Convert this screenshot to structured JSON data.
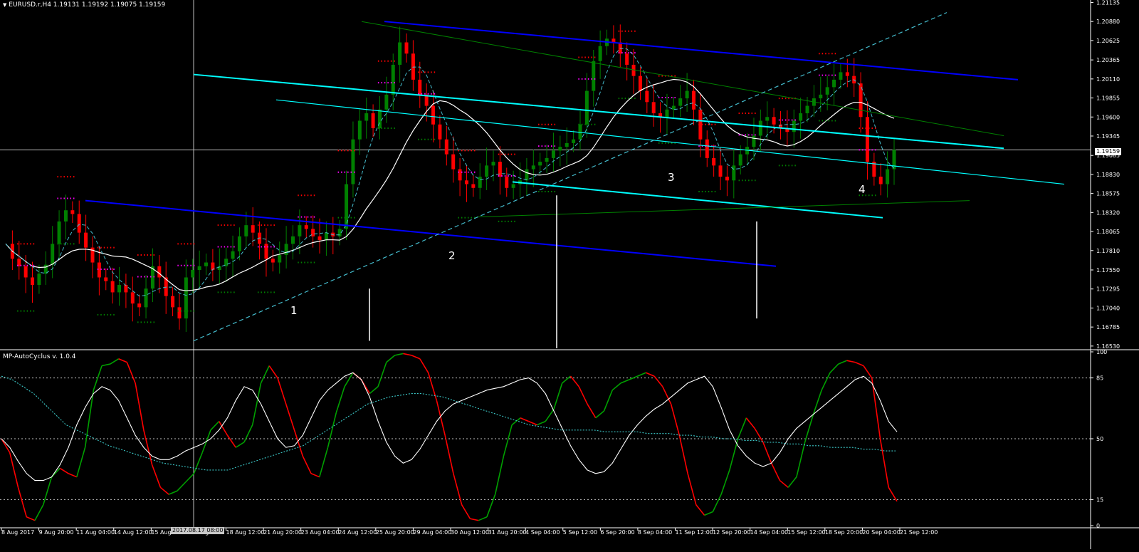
{
  "window": {
    "symbol_info": "EURUSD.r,H4  1.19131 1.19192 1.19075 1.19159",
    "indicator_title": "MP-AutoCyclus v. 1.0.4",
    "current_price": "1.19159",
    "crosshair_time": "2017.08.17 08:00"
  },
  "colors": {
    "background": "#000000",
    "bull": "#008000",
    "bear": "#ff0000",
    "ma": "#ffffff",
    "channel_blue": "#0000ff",
    "channel_cyan": "#00ffff",
    "trend_green": "#008000",
    "dashed_cyan": "#44bbcc",
    "osc_green": "#00a000",
    "osc_red": "#ff0000",
    "osc_signal": "#ffffff",
    "osc_slow": "#3cc8c8",
    "grid": "#c0c0c0"
  },
  "chart_data": [
    {
      "type": "candlestick",
      "title": "EURUSD.r,H4",
      "ohlc_last": {
        "open": 1.19131,
        "high": 1.19192,
        "low": 1.19075,
        "close": 1.19159
      },
      "ylim": [
        1.165,
        1.2113
      ],
      "y_ticks": [
        "1.21135",
        "1.20880",
        "1.20625",
        "1.20365",
        "1.20110",
        "1.19855",
        "1.19600",
        "1.19345",
        "1.19085",
        "1.18830",
        "1.18575",
        "1.18320",
        "1.18065",
        "1.17810",
        "1.17550",
        "1.17295",
        "1.17040",
        "1.16785",
        "1.16530"
      ],
      "x_ticks": [
        "8 Aug 2017",
        "9 Aug 20:00",
        "11 Aug 04:00",
        "14 Aug 12:00",
        "15 Aug",
        "17 Aug",
        "18 Aug 12:00",
        "21 Aug 20:00",
        "23 Aug 04:00",
        "24 Aug 12:00",
        "25 Aug 20:00",
        "29 Aug 04:00",
        "30 Aug 12:00",
        "31 Aug 20:00",
        "4 Sep 04:00",
        "5 Sep 12:00",
        "6 Sep 20:00",
        "8 Sep 04:00",
        "11 Sep 12:00",
        "12 Sep 20:00",
        "14 Sep 04:00",
        "15 Sep 12:00",
        "18 Sep 20:00",
        "20 Sep 04:00",
        "21 Sep 12:00"
      ],
      "annotations": [
        "1",
        "2",
        "3",
        "4"
      ],
      "close_path": [
        1.179,
        1.177,
        1.176,
        1.1745,
        1.1735,
        1.175,
        1.1762,
        1.179,
        1.182,
        1.1835,
        1.183,
        1.1805,
        1.1785,
        1.1765,
        1.1745,
        1.174,
        1.1725,
        1.1735,
        1.1725,
        1.171,
        1.1705,
        1.173,
        1.176,
        1.1745,
        1.172,
        1.1705,
        1.169,
        1.1745,
        1.1755,
        1.176,
        1.1765,
        1.1755,
        1.176,
        1.177,
        1.178,
        1.18,
        1.1815,
        1.1805,
        1.179,
        1.177,
        1.1765,
        1.1775,
        1.179,
        1.18,
        1.1815,
        1.181,
        1.18,
        1.1795,
        1.1805,
        1.18,
        1.181,
        1.187,
        1.193,
        1.1955,
        1.1965,
        1.1945,
        1.197,
        1.199,
        1.203,
        1.206,
        1.2045,
        1.201,
        1.199,
        1.1975,
        1.195,
        1.193,
        1.191,
        1.189,
        1.1875,
        1.187,
        1.1865,
        1.188,
        1.1895,
        1.19,
        1.188,
        1.1865,
        1.187,
        1.1875,
        1.189,
        1.1895,
        1.19,
        1.1905,
        1.1915,
        1.192,
        1.1925,
        1.193,
        1.195,
        1.1995,
        1.2035,
        1.2055,
        1.2065,
        1.206,
        1.2045,
        1.203,
        1.2015,
        1.1995,
        1.198,
        1.1965,
        1.196,
        1.197,
        1.1975,
        1.1985,
        1.1995,
        1.197,
        1.193,
        1.1905,
        1.1895,
        1.188,
        1.1875,
        1.1895,
        1.191,
        1.192,
        1.1935,
        1.1955,
        1.196,
        1.195,
        1.1945,
        1.194,
        1.1955,
        1.1965,
        1.1975,
        1.1985,
        1.199,
        1.2,
        1.201,
        1.202,
        1.2015,
        1.2005,
        1.196,
        1.19,
        1.188,
        1.187,
        1.189,
        1.1916
      ]
    },
    {
      "type": "line",
      "title": "MP-AutoCyclus v. 1.0.4",
      "ylim": [
        0,
        100
      ],
      "y_ticks": [
        "100",
        "85",
        "50",
        "15",
        "0"
      ],
      "series": [
        {
          "values": [
            50,
            42,
            22,
            5,
            3,
            12,
            28,
            33,
            30,
            28,
            45,
            78,
            92,
            93,
            96,
            94,
            82,
            55,
            35,
            22,
            18,
            20,
            25,
            30,
            42,
            55,
            60,
            52,
            45,
            48,
            58,
            82,
            92,
            85,
            70,
            55,
            40,
            30,
            28,
            45,
            65,
            80,
            88,
            84,
            76,
            80,
            94,
            98,
            99,
            98,
            96,
            88,
            72,
            52,
            30,
            12,
            4,
            3,
            5,
            18,
            40,
            58,
            62,
            60,
            58,
            60,
            67,
            82,
            86,
            80,
            70,
            62,
            66,
            78,
            82,
            84,
            86,
            88,
            86,
            80,
            70,
            52,
            30,
            12,
            6,
            8,
            18,
            32,
            50,
            62,
            56,
            48,
            36,
            26,
            22,
            28,
            48,
            64,
            78,
            88,
            93,
            95,
            94,
            92,
            85,
            50,
            22,
            14
          ]
        },
        {
          "values": [
            50,
            45,
            37,
            30,
            26,
            26,
            28,
            35,
            45,
            58,
            68,
            76,
            80,
            78,
            72,
            62,
            52,
            45,
            40,
            38,
            38,
            40,
            43,
            45,
            47,
            50,
            55,
            62,
            72,
            80,
            78,
            70,
            60,
            50,
            45,
            46,
            52,
            62,
            72,
            78,
            82,
            86,
            88,
            84,
            74,
            60,
            48,
            40,
            36,
            38,
            44,
            52,
            60,
            66,
            70,
            72,
            74,
            76,
            78,
            79,
            80,
            82,
            84,
            85,
            82,
            76,
            66,
            56,
            46,
            38,
            32,
            30,
            31,
            36,
            44,
            52,
            58,
            63,
            67,
            70,
            74,
            78,
            82,
            84,
            86,
            80,
            68,
            55,
            46,
            40,
            36,
            34,
            36,
            42,
            50,
            56,
            60,
            64,
            68,
            72,
            76,
            80,
            84,
            86,
            82,
            72,
            60,
            54
          ]
        },
        {
          "values": [
            86,
            84,
            80,
            76,
            70,
            64,
            58,
            55,
            52,
            49,
            46,
            44,
            42,
            40,
            38,
            36,
            35,
            34,
            33,
            32,
            32,
            32,
            34,
            36,
            38,
            40,
            42,
            44,
            46,
            50,
            54,
            58,
            62,
            66,
            70,
            72,
            74,
            75,
            76,
            76,
            75,
            74,
            72,
            70,
            68,
            66,
            64,
            62,
            60,
            58,
            57,
            56,
            55,
            55,
            55,
            55,
            54,
            54,
            54,
            54,
            53,
            53,
            53,
            52,
            52,
            51,
            51,
            50,
            50,
            49,
            49,
            48,
            48,
            47,
            47,
            46,
            46,
            45,
            45,
            45,
            44,
            44,
            43,
            43
          ]
        }
      ]
    }
  ]
}
